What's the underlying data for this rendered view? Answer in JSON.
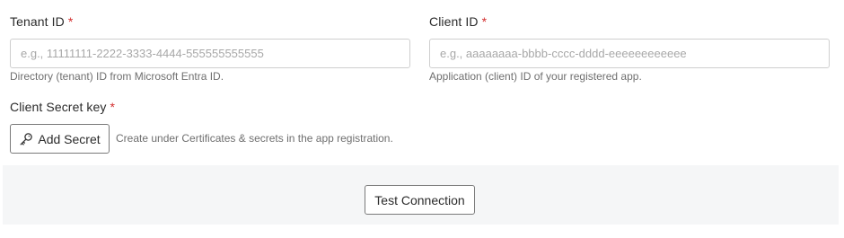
{
  "tenant": {
    "label": "Tenant ID",
    "required_mark": "*",
    "value": "",
    "placeholder": "e.g., 11111111-2222-3333-4444-555555555555",
    "help": "Directory (tenant) ID from Microsoft Entra ID."
  },
  "client": {
    "label": "Client ID",
    "required_mark": "*",
    "value": "",
    "placeholder": "e.g., aaaaaaaa-bbbb-cccc-dddd-eeeeeeeeeeee",
    "help": "Application (client) ID of your registered app."
  },
  "secret": {
    "label": "Client Secret key",
    "required_mark": "*",
    "button_label": "Add Secret",
    "button_icon": "key-icon",
    "help": "Create under Certificates & secrets in the app registration."
  },
  "footer": {
    "test_button_label": "Test Connection"
  },
  "colors": {
    "required": "#d32f2f",
    "footer_background": "#f5f6f7",
    "input_border": "#cfcfcf",
    "button_border": "#7a7a7a"
  }
}
